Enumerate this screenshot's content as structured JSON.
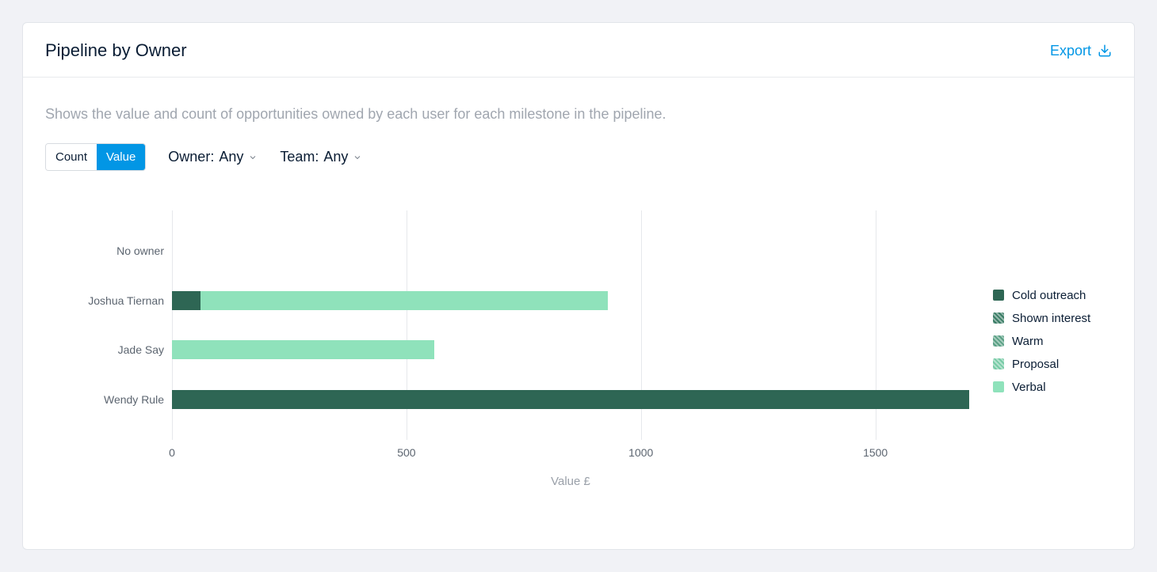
{
  "header": {
    "title": "Pipeline by Owner",
    "export_label": "Export"
  },
  "description": "Shows the value and count of opportunities owned by each user for each milestone in the pipeline.",
  "toggle": {
    "count_label": "Count",
    "value_label": "Value",
    "active": "value"
  },
  "filters": {
    "owner_label": "Owner:",
    "owner_value": "Any",
    "team_label": "Team:",
    "team_value": "Any"
  },
  "legend": [
    {
      "name": "Cold outreach",
      "color": "#2e6654",
      "hatched": false
    },
    {
      "name": "Shown interest",
      "color": "#3b7d66",
      "hatched": true
    },
    {
      "name": "Warm",
      "color": "#5aa085",
      "hatched": true
    },
    {
      "name": "Proposal",
      "color": "#77cba6",
      "hatched": true
    },
    {
      "name": "Verbal",
      "color": "#8fe2bb",
      "hatched": false
    }
  ],
  "chart_data": {
    "type": "bar",
    "orientation": "horizontal",
    "stacked": true,
    "x_ticks": [
      0,
      500,
      1000,
      1500
    ],
    "xlim": [
      0,
      1700
    ],
    "xlabel": "Value £",
    "categories": [
      "No owner",
      "Joshua Tiernan",
      "Jade Say",
      "Wendy Rule"
    ],
    "series": [
      {
        "name": "Cold outreach",
        "color": "#2e6654",
        "values": [
          0,
          60,
          0,
          1700
        ]
      },
      {
        "name": "Shown interest",
        "color": "#3b7d66",
        "values": [
          0,
          0,
          0,
          0
        ]
      },
      {
        "name": "Warm",
        "color": "#5aa085",
        "values": [
          0,
          0,
          0,
          0
        ]
      },
      {
        "name": "Proposal",
        "color": "#77cba6",
        "values": [
          0,
          0,
          0,
          0
        ]
      },
      {
        "name": "Verbal",
        "color": "#8fe2bb",
        "values": [
          0,
          870,
          560,
          0
        ]
      }
    ]
  }
}
